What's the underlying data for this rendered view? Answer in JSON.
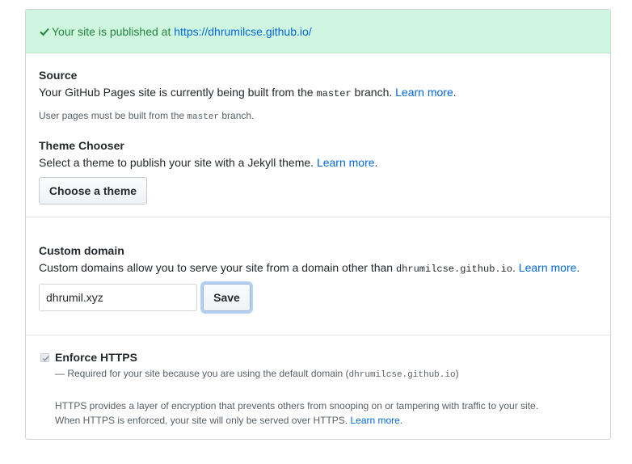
{
  "flash": {
    "icon": "check-icon",
    "message": "Your site is published at ",
    "url": "https://dhrumilcse.github.io/"
  },
  "source": {
    "title": "Source",
    "desc_prefix": "Your GitHub Pages site is currently being built from the ",
    "branch": "master",
    "desc_suffix": " branch. ",
    "learn_more": "Learn more",
    "period": ".",
    "note_prefix": "User pages must be built from the ",
    "note_branch": "master",
    "note_suffix": " branch."
  },
  "theme": {
    "title": "Theme Chooser",
    "desc": "Select a theme to publish your site with a Jekyll theme. ",
    "learn_more": "Learn more",
    "period": ".",
    "button": "Choose a theme"
  },
  "domain": {
    "title": "Custom domain",
    "desc_prefix": "Custom domains allow you to serve your site from a domain other than ",
    "default_domain": "dhrumilcse.github.io",
    "desc_suffix": ". ",
    "learn_more": "Learn more",
    "period": ".",
    "input_value": "dhrumil.xyz",
    "save": "Save"
  },
  "https": {
    "title": "Enforce HTTPS",
    "checked": true,
    "note_prefix": "— Required for your site because you are using the default domain (",
    "note_domain": "dhrumilcse.github.io",
    "note_suffix": ")",
    "info_line1": "HTTPS provides a layer of encryption that prevents others from snooping on or tampering with traffic to your site.",
    "info_line2_prefix": "When HTTPS is enforced, your site will only be served over HTTPS. ",
    "learn_more": "Learn more",
    "period": "."
  },
  "colors": {
    "flash_bg": "#cff7e0",
    "flash_text": "#22863a",
    "link": "#0366d6"
  }
}
